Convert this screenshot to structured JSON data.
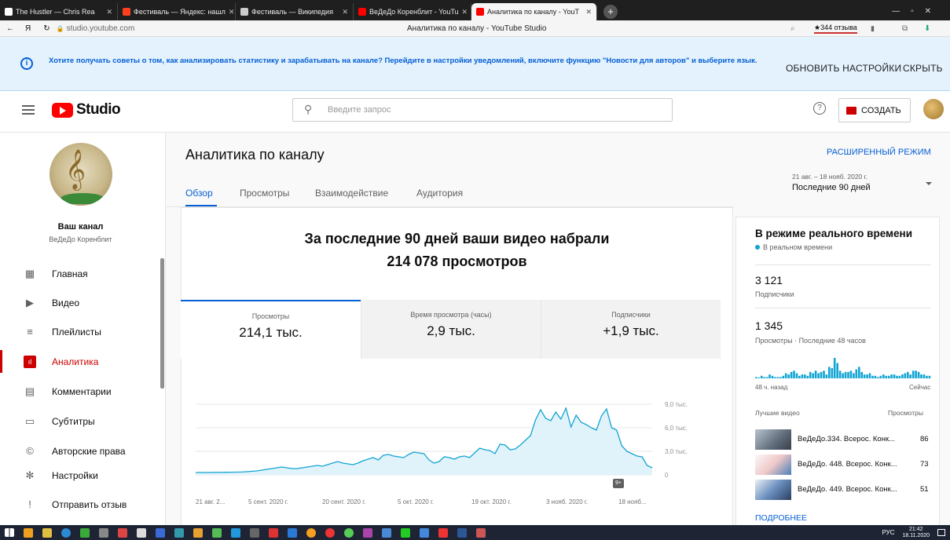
{
  "browser": {
    "tabs": [
      {
        "label": "The Hustler — Chris Rea",
        "color": "#ffffff"
      },
      {
        "label": "Фестиваль — Яндекс: нашл",
        "color": "#fc3f1d"
      },
      {
        "label": "Фестиваль — Википедия",
        "color": "#cccccc"
      },
      {
        "label": "ВеДеДо Коренблит - YouTu",
        "color": "#ff0000"
      },
      {
        "label": "Аналитика по каналу - YouT",
        "color": "#ff0000"
      }
    ],
    "url": "studio.youtube.com",
    "page_title": "Аналитика по каналу - YouTube Studio",
    "reviews": "★344 отзыва"
  },
  "banner": {
    "message": "Хотите получать советы о том, как анализировать статистику и зарабатывать на канале? Перейдите в настройки уведомлений, включите функцию \"Новости для авторов\" и выберите язык.",
    "update_btn": "ОБНОВИТЬ НАСТРОЙКИ",
    "hide_btn": "СКРЫТЬ"
  },
  "header": {
    "logo": "Studio",
    "search_placeholder": "Введите запрос",
    "create_btn": "СОЗДАТЬ"
  },
  "sidebar": {
    "channel_title": "Ваш канал",
    "channel_name": "ВеДеДо Коренблит",
    "items": [
      {
        "label": "Главная",
        "icon": "dashboard-icon"
      },
      {
        "label": "Видео",
        "icon": "video-icon"
      },
      {
        "label": "Плейлисты",
        "icon": "playlist-icon"
      },
      {
        "label": "Аналитика",
        "icon": "analytics-icon",
        "active": true
      },
      {
        "label": "Комментарии",
        "icon": "comments-icon"
      },
      {
        "label": "Субтитры",
        "icon": "subtitles-icon"
      },
      {
        "label": "Авторские права",
        "icon": "copyright-icon"
      },
      {
        "label": "Настройки",
        "icon": "settings-icon"
      },
      {
        "label": "Отправить отзыв",
        "icon": "feedback-icon"
      }
    ]
  },
  "main": {
    "title": "Аналитика по каналу",
    "advanced": "РАСШИРЕННЫЙ РЕЖИМ",
    "date_range": "21 авг. – 18 нояб. 2020 г.",
    "date_label": "Последние 90 дней",
    "tabs": [
      "Обзор",
      "Просмотры",
      "Взаимодействие",
      "Аудитория"
    ],
    "headline1": "За последние 90 дней ваши видео набрали",
    "headline2": "214 078 просмотров",
    "metrics": [
      {
        "title": "Просмотры",
        "value": "214,1 тыс."
      },
      {
        "title": "Время просмотра (часы)",
        "value": "2,9 тыс."
      },
      {
        "title": "Подписчики",
        "value": "+1,9 тыс."
      }
    ],
    "badge": "9+"
  },
  "chart_data": {
    "type": "area",
    "x": [
      "21 авг. 2...",
      "5 сент. 2020 г.",
      "20 сент. 2020 г.",
      "5 окт. 2020 г.",
      "19 окт. 2020 г.",
      "3 нояб. 2020 г.",
      "18 нояб..."
    ],
    "yticks": [
      "9,0 тыс.",
      "6,0 тыс.",
      "3,0 тыс.",
      "0"
    ],
    "ylim": [
      0,
      9000
    ],
    "color": "#12a4d3",
    "values": [
      300,
      300,
      300,
      300,
      320,
      310,
      330,
      340,
      350,
      360,
      400,
      450,
      500,
      600,
      700,
      800,
      900,
      1000,
      900,
      800,
      800,
      900,
      1000,
      1100,
      1200,
      1100,
      1300,
      1500,
      1700,
      1500,
      1400,
      1300,
      1500,
      1800,
      2000,
      2200,
      1900,
      2500,
      2600,
      2400,
      2300,
      2200,
      2600,
      2900,
      2800,
      2700,
      1900,
      1500,
      1700,
      2300,
      2200,
      2000,
      2300,
      2400,
      2200,
      2800,
      3400,
      3200,
      3100,
      2700,
      3900,
      3800,
      3200,
      3300,
      3800,
      4400,
      5000,
      7000,
      8300,
      7200,
      6900,
      8000,
      7100,
      8500,
      6100,
      7600,
      6700,
      6400,
      6000,
      5700,
      7500,
      8400,
      6000,
      5700,
      3700,
      3000,
      2700,
      2400,
      2300,
      1200,
      900
    ]
  },
  "realtime": {
    "title": "В режиме реального времени",
    "live": "В реальном времени",
    "subs": "3 121",
    "subs_label": "Подписчики",
    "views": "1 345",
    "views_label": "Просмотры · Последние 48 часов",
    "ago": "48 ч. назад",
    "now": "Сейчас",
    "top_label": "Лучшие видео",
    "views_col": "Просмотры",
    "bars": [
      1,
      0,
      2,
      1,
      1,
      3,
      2,
      1,
      1,
      1,
      2,
      4,
      3,
      5,
      6,
      4,
      2,
      3,
      3,
      2,
      5,
      4,
      6,
      4,
      5,
      6,
      3,
      9,
      8,
      16,
      12,
      6,
      4,
      5,
      5,
      6,
      4,
      7,
      9,
      5,
      3,
      3,
      4,
      2,
      2,
      1,
      2,
      3,
      2,
      2,
      3,
      3,
      2,
      2,
      3,
      4,
      5,
      3,
      6,
      6,
      5,
      3,
      3,
      2,
      2
    ],
    "top": [
      {
        "title": "ВеДеДо.334. Всерос. Конк...",
        "views": "86"
      },
      {
        "title": "ВеДеДо. 448. Всерос. Конк...",
        "views": "73"
      },
      {
        "title": "ВеДеДо. 449. Всерос. Конк...",
        "views": "51"
      }
    ],
    "more": "ПОДРОБНЕЕ"
  },
  "taskbar": {
    "lang": "РУС",
    "time": "21:42",
    "date": "18.11.2020"
  }
}
